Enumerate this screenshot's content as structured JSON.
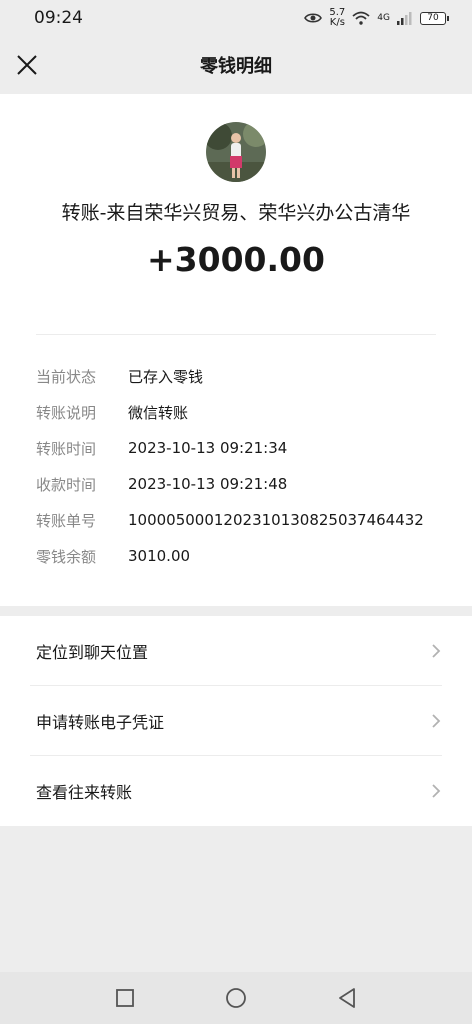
{
  "status_bar": {
    "time": "09:24",
    "net_speed_value": "5.7",
    "net_speed_unit": "K/s",
    "network_type": "4G",
    "battery": "70"
  },
  "header": {
    "title": "零钱明细",
    "close_icon": "close-icon"
  },
  "transfer": {
    "from": "转账-来自荣华兴贸易、荣华兴办公古清华",
    "amount": "+3000.00"
  },
  "details": [
    {
      "label": "当前状态",
      "value": "已存入零钱"
    },
    {
      "label": "转账说明",
      "value": "微信转账"
    },
    {
      "label": "转账时间",
      "value": "2023-10-13 09:21:34"
    },
    {
      "label": "收款时间",
      "value": "2023-10-13 09:21:48"
    },
    {
      "label": "转账单号",
      "value": "1000050001202310130825037464432"
    },
    {
      "label": "零钱余额",
      "value": "3010.00"
    }
  ],
  "actions": [
    {
      "label": "定位到聊天位置"
    },
    {
      "label": "申请转账电子凭证"
    },
    {
      "label": "查看往来转账"
    }
  ],
  "colors": {
    "background": "#ededed",
    "card": "#ffffff",
    "label_gray": "#888888"
  }
}
